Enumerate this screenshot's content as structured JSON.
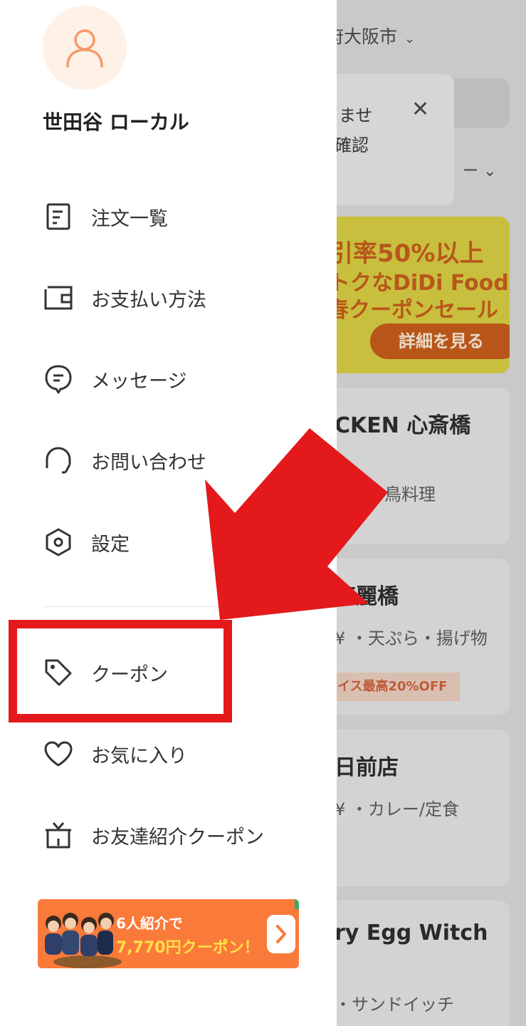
{
  "background": {
    "location": "府大阪市",
    "popup_line1": "ませ",
    "popup_line2": "確認",
    "popup_close": "✕",
    "sort_label": "ー ⌄",
    "banner": {
      "line1": "引率50%以上",
      "line2": "トクなDiDi Food",
      "line3": "春クーポンセール",
      "button": "詳細を見る"
    },
    "cards": [
      {
        "title": "CKEN 心斎橋",
        "subtitle": "鳥料理",
        "tag": ""
      },
      {
        "title": "高麗橋",
        "subtitle": "¥ ・天ぷら・揚げ物",
        "tag": "イス最高20%OFF"
      },
      {
        "title": "日前店",
        "subtitle": "¥ ・カレー/定食",
        "tag": ""
      },
      {
        "title": "ry Egg Witch",
        "subtitle": "・サンドイッチ",
        "tag": ""
      }
    ]
  },
  "drawer": {
    "username": "世田谷 ローカル",
    "menu": [
      {
        "icon": "receipt-icon",
        "label": "注文一覧"
      },
      {
        "icon": "wallet-icon",
        "label": "お支払い方法"
      },
      {
        "icon": "message-icon",
        "label": "メッセージ"
      },
      {
        "icon": "headset-icon",
        "label": "お問い合わせ"
      },
      {
        "icon": "settings-icon",
        "label": "設定"
      },
      {
        "icon": "tag-icon",
        "label": "クーポン"
      },
      {
        "icon": "heart-icon",
        "label": "お気に入り"
      },
      {
        "icon": "gift-icon",
        "label": "お友達紹介クーポン"
      }
    ],
    "promo": {
      "line1": "6人紹介で",
      "line2": "7,770円クーポン！"
    }
  },
  "colors": {
    "annotation_red": "#e3191b",
    "accent_orange": "#fa7a3a",
    "avatar_orange": "#f59a6a"
  }
}
